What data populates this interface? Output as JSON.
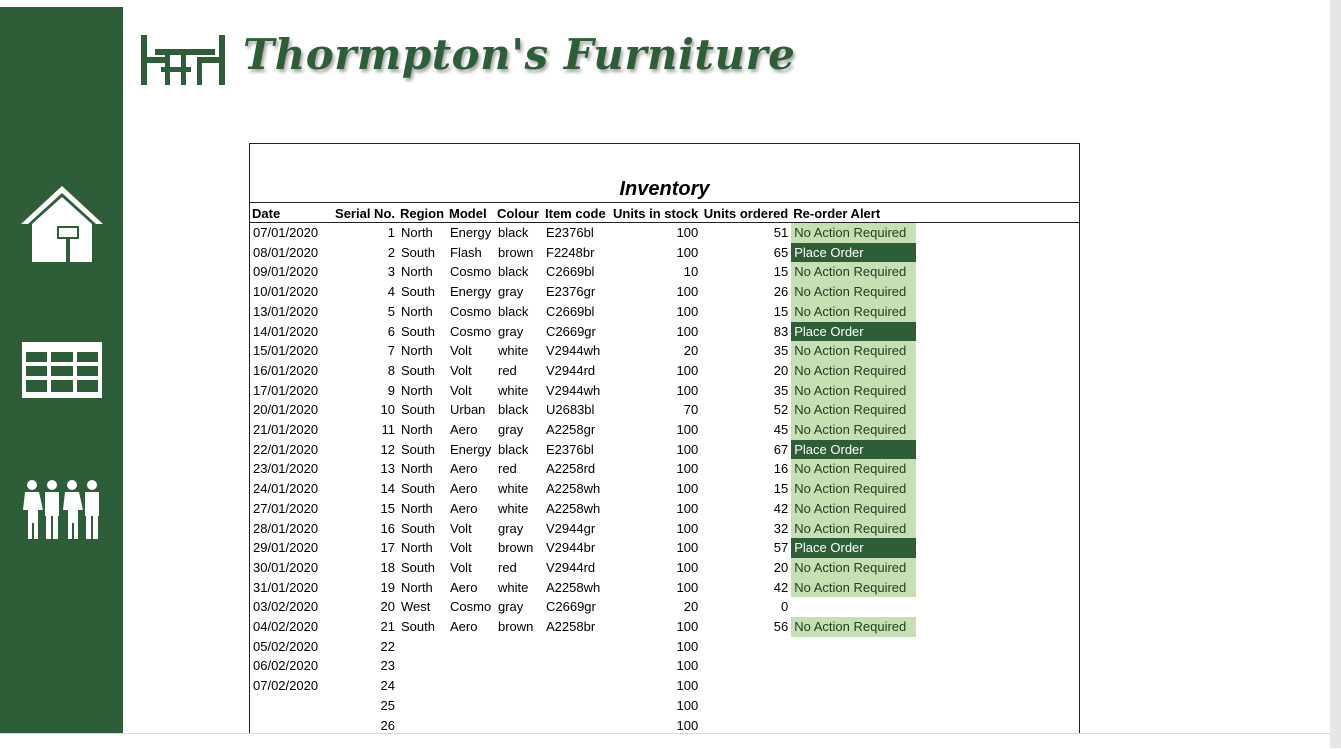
{
  "app": {
    "brand_name": "Thormpton's Furniture"
  },
  "nav": {
    "items": [
      {
        "name": "home",
        "icon": "house-icon"
      },
      {
        "name": "inventory",
        "icon": "table-grid-icon"
      },
      {
        "name": "people",
        "icon": "people-icon"
      }
    ]
  },
  "colors": {
    "sidebar": "#2e5e38",
    "alert_ok": "#c6e0b4",
    "alert_place": "#2e5e38"
  },
  "sheet": {
    "title": "Inventory",
    "headers": {
      "date": "Date",
      "serial": "Serial No.",
      "region": "Region",
      "model": "Model",
      "colour": "Colour",
      "item_code": "Item code",
      "units_in_stock": "Units in stock",
      "units_ordered": "Units ordered",
      "reorder_alert": "Re-order Alert"
    },
    "rows": [
      {
        "date": "07/01/2020",
        "serial": "1",
        "region": "North",
        "model": "Energy",
        "colour": "black",
        "item_code": "E2376bl",
        "stock": "100",
        "ordered": "51",
        "alert": "No Action Required"
      },
      {
        "date": "08/01/2020",
        "serial": "2",
        "region": "South",
        "model": "Flash",
        "colour": "brown",
        "item_code": "F2248br",
        "stock": "100",
        "ordered": "65",
        "alert": "Place Order"
      },
      {
        "date": "09/01/2020",
        "serial": "3",
        "region": "North",
        "model": "Cosmo",
        "colour": "black",
        "item_code": "C2669bl",
        "stock": "10",
        "ordered": "15",
        "alert": "No Action Required"
      },
      {
        "date": "10/01/2020",
        "serial": "4",
        "region": "South",
        "model": "Energy",
        "colour": "gray",
        "item_code": "E2376gr",
        "stock": "100",
        "ordered": "26",
        "alert": "No Action Required"
      },
      {
        "date": "13/01/2020",
        "serial": "5",
        "region": "North",
        "model": "Cosmo",
        "colour": "black",
        "item_code": "C2669bl",
        "stock": "100",
        "ordered": "15",
        "alert": "No Action Required"
      },
      {
        "date": "14/01/2020",
        "serial": "6",
        "region": "South",
        "model": "Cosmo",
        "colour": "gray",
        "item_code": "C2669gr",
        "stock": "100",
        "ordered": "83",
        "alert": "Place Order"
      },
      {
        "date": "15/01/2020",
        "serial": "7",
        "region": "North",
        "model": "Volt",
        "colour": "white",
        "item_code": "V2944wh",
        "stock": "20",
        "ordered": "35",
        "alert": "No Action Required"
      },
      {
        "date": "16/01/2020",
        "serial": "8",
        "region": "South",
        "model": "Volt",
        "colour": "red",
        "item_code": "V2944rd",
        "stock": "100",
        "ordered": "20",
        "alert": "No Action Required"
      },
      {
        "date": "17/01/2020",
        "serial": "9",
        "region": "North",
        "model": "Volt",
        "colour": "white",
        "item_code": "V2944wh",
        "stock": "100",
        "ordered": "35",
        "alert": "No Action Required"
      },
      {
        "date": "20/01/2020",
        "serial": "10",
        "region": "South",
        "model": "Urban",
        "colour": "black",
        "item_code": "U2683bl",
        "stock": "70",
        "ordered": "52",
        "alert": "No Action Required"
      },
      {
        "date": "21/01/2020",
        "serial": "11",
        "region": "North",
        "model": "Aero",
        "colour": "gray",
        "item_code": "A2258gr",
        "stock": "100",
        "ordered": "45",
        "alert": "No Action Required"
      },
      {
        "date": "22/01/2020",
        "serial": "12",
        "region": "South",
        "model": "Energy",
        "colour": "black",
        "item_code": "E2376bl",
        "stock": "100",
        "ordered": "67",
        "alert": "Place Order"
      },
      {
        "date": "23/01/2020",
        "serial": "13",
        "region": "North",
        "model": "Aero",
        "colour": "red",
        "item_code": "A2258rd",
        "stock": "100",
        "ordered": "16",
        "alert": "No Action Required"
      },
      {
        "date": "24/01/2020",
        "serial": "14",
        "region": "South",
        "model": "Aero",
        "colour": "white",
        "item_code": "A2258wh",
        "stock": "100",
        "ordered": "15",
        "alert": "No Action Required"
      },
      {
        "date": "27/01/2020",
        "serial": "15",
        "region": "North",
        "model": "Aero",
        "colour": "white",
        "item_code": "A2258wh",
        "stock": "100",
        "ordered": "42",
        "alert": "No Action Required"
      },
      {
        "date": "28/01/2020",
        "serial": "16",
        "region": "South",
        "model": "Volt",
        "colour": "gray",
        "item_code": "V2944gr",
        "stock": "100",
        "ordered": "32",
        "alert": "No Action Required"
      },
      {
        "date": "29/01/2020",
        "serial": "17",
        "region": "North",
        "model": "Volt",
        "colour": "brown",
        "item_code": "V2944br",
        "stock": "100",
        "ordered": "57",
        "alert": "Place Order"
      },
      {
        "date": "30/01/2020",
        "serial": "18",
        "region": "South",
        "model": "Volt",
        "colour": "red",
        "item_code": "V2944rd",
        "stock": "100",
        "ordered": "20",
        "alert": "No Action Required"
      },
      {
        "date": "31/01/2020",
        "serial": "19",
        "region": "North",
        "model": "Aero",
        "colour": "white",
        "item_code": "A2258wh",
        "stock": "100",
        "ordered": "42",
        "alert": "No Action Required"
      },
      {
        "date": "03/02/2020",
        "serial": "20",
        "region": "West",
        "model": "Cosmo",
        "colour": "gray",
        "item_code": "C2669gr",
        "stock": "20",
        "ordered": "0",
        "alert": ""
      },
      {
        "date": "04/02/2020",
        "serial": "21",
        "region": "South",
        "model": "Aero",
        "colour": "brown",
        "item_code": "A2258br",
        "stock": "100",
        "ordered": "56",
        "alert": "No Action Required"
      },
      {
        "date": "05/02/2020",
        "serial": "22",
        "region": "",
        "model": "",
        "colour": "",
        "item_code": "",
        "stock": "100",
        "ordered": "",
        "alert": ""
      },
      {
        "date": "06/02/2020",
        "serial": "23",
        "region": "",
        "model": "",
        "colour": "",
        "item_code": "",
        "stock": "100",
        "ordered": "",
        "alert": ""
      },
      {
        "date": "07/02/2020",
        "serial": "24",
        "region": "",
        "model": "",
        "colour": "",
        "item_code": "",
        "stock": "100",
        "ordered": "",
        "alert": ""
      },
      {
        "date": "",
        "serial": "25",
        "region": "",
        "model": "",
        "colour": "",
        "item_code": "",
        "stock": "100",
        "ordered": "",
        "alert": ""
      },
      {
        "date": "",
        "serial": "26",
        "region": "",
        "model": "",
        "colour": "",
        "item_code": "",
        "stock": "100",
        "ordered": "",
        "alert": ""
      }
    ]
  }
}
